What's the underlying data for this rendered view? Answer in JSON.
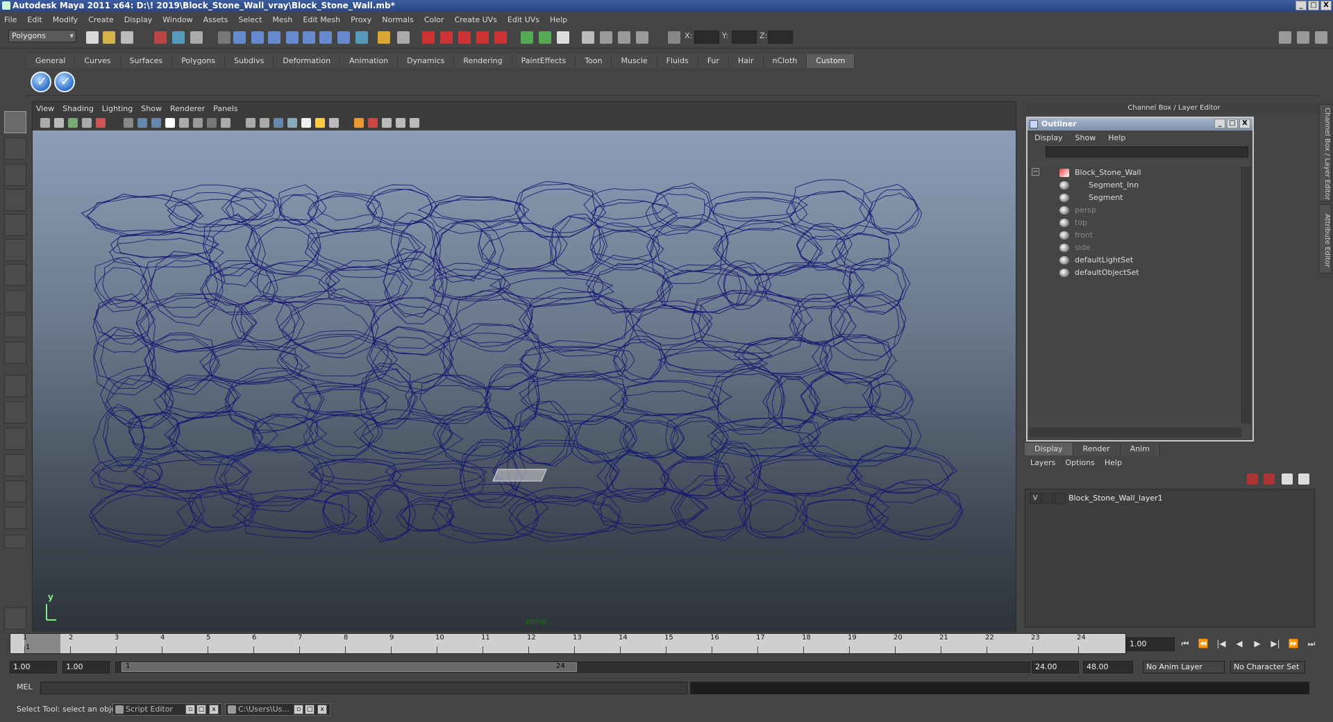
{
  "window": {
    "title": "Autodesk Maya 2011 x64: D:\\! 2019\\Block_Stone_Wall_vray\\Block_Stone_Wall.mb*",
    "min": "_",
    "max": "□",
    "close": "X"
  },
  "menubar": [
    "File",
    "Edit",
    "Modify",
    "Create",
    "Display",
    "Window",
    "Assets",
    "Select",
    "Mesh",
    "Edit Mesh",
    "Proxy",
    "Normals",
    "Color",
    "Create UVs",
    "Edit UVs",
    "Help"
  ],
  "status": {
    "mode": "Polygons",
    "x_label": "X:",
    "y_label": "Y:",
    "z_label": "Z:"
  },
  "shelf": {
    "tabs": [
      "General",
      "Curves",
      "Surfaces",
      "Polygons",
      "Subdivs",
      "Deformation",
      "Animation",
      "Dynamics",
      "Rendering",
      "PaintEffects",
      "Toon",
      "Muscle",
      "Fluids",
      "Fur",
      "Hair",
      "nCloth",
      "Custom"
    ],
    "active_tab": "Custom"
  },
  "viewport": {
    "menu": [
      "View",
      "Shading",
      "Lighting",
      "Show",
      "Renderer",
      "Panels"
    ],
    "camera": "persp",
    "axis_y": "y",
    "wire_color": "#141470"
  },
  "right_panel": {
    "header": "Channel Box / Layer Editor",
    "side_tabs": [
      "Channel Box / Layer Editor",
      "Attribute Editor"
    ]
  },
  "outliner": {
    "title": "Outliner",
    "menu": [
      "Display",
      "Show",
      "Help"
    ],
    "items": [
      {
        "label": "Block_Stone_Wall",
        "indent": 0,
        "dim": false
      },
      {
        "label": "Segment_Inn",
        "indent": 1,
        "dim": false
      },
      {
        "label": "Segment",
        "indent": 1,
        "dim": false
      },
      {
        "label": "persp",
        "indent": 0,
        "dim": true
      },
      {
        "label": "top",
        "indent": 0,
        "dim": true
      },
      {
        "label": "front",
        "indent": 0,
        "dim": true
      },
      {
        "label": "side",
        "indent": 0,
        "dim": true
      },
      {
        "label": "defaultLightSet",
        "indent": 0,
        "dim": false
      },
      {
        "label": "defaultObjectSet",
        "indent": 0,
        "dim": false
      }
    ],
    "collapse": "−"
  },
  "layers": {
    "tabs": [
      "Display",
      "Render",
      "Anim"
    ],
    "active_tab": "Display",
    "menu": [
      "Layers",
      "Options",
      "Help"
    ],
    "rows": [
      {
        "visible": "V",
        "name": "Block_Stone_Wall_layer1"
      }
    ]
  },
  "timeline": {
    "ticks": [
      "1",
      "2",
      "3",
      "4",
      "5",
      "6",
      "7",
      "8",
      "9",
      "10",
      "11",
      "12",
      "13",
      "14",
      "15",
      "16",
      "17",
      "18",
      "19",
      "20",
      "21",
      "22",
      "23",
      "24"
    ],
    "current_frame": "1",
    "current_time": "1.00",
    "play_buttons": [
      "⏮",
      "⏪",
      "|◀",
      "◀",
      "▶",
      "▶|",
      "⏩",
      "⏭"
    ]
  },
  "range": {
    "start_time": "1.00",
    "playback_start": "1.00",
    "slider_start": "1",
    "slider_end": "24",
    "playback_end": "24.00",
    "end_time": "48.00",
    "anim_layer": "No Anim Layer",
    "character_set": "No Character Set"
  },
  "command": {
    "label": "MEL"
  },
  "help": {
    "text": "Select Tool: select an object",
    "tasks": [
      "Script Editor",
      "C:\\Users\\Us..."
    ]
  }
}
